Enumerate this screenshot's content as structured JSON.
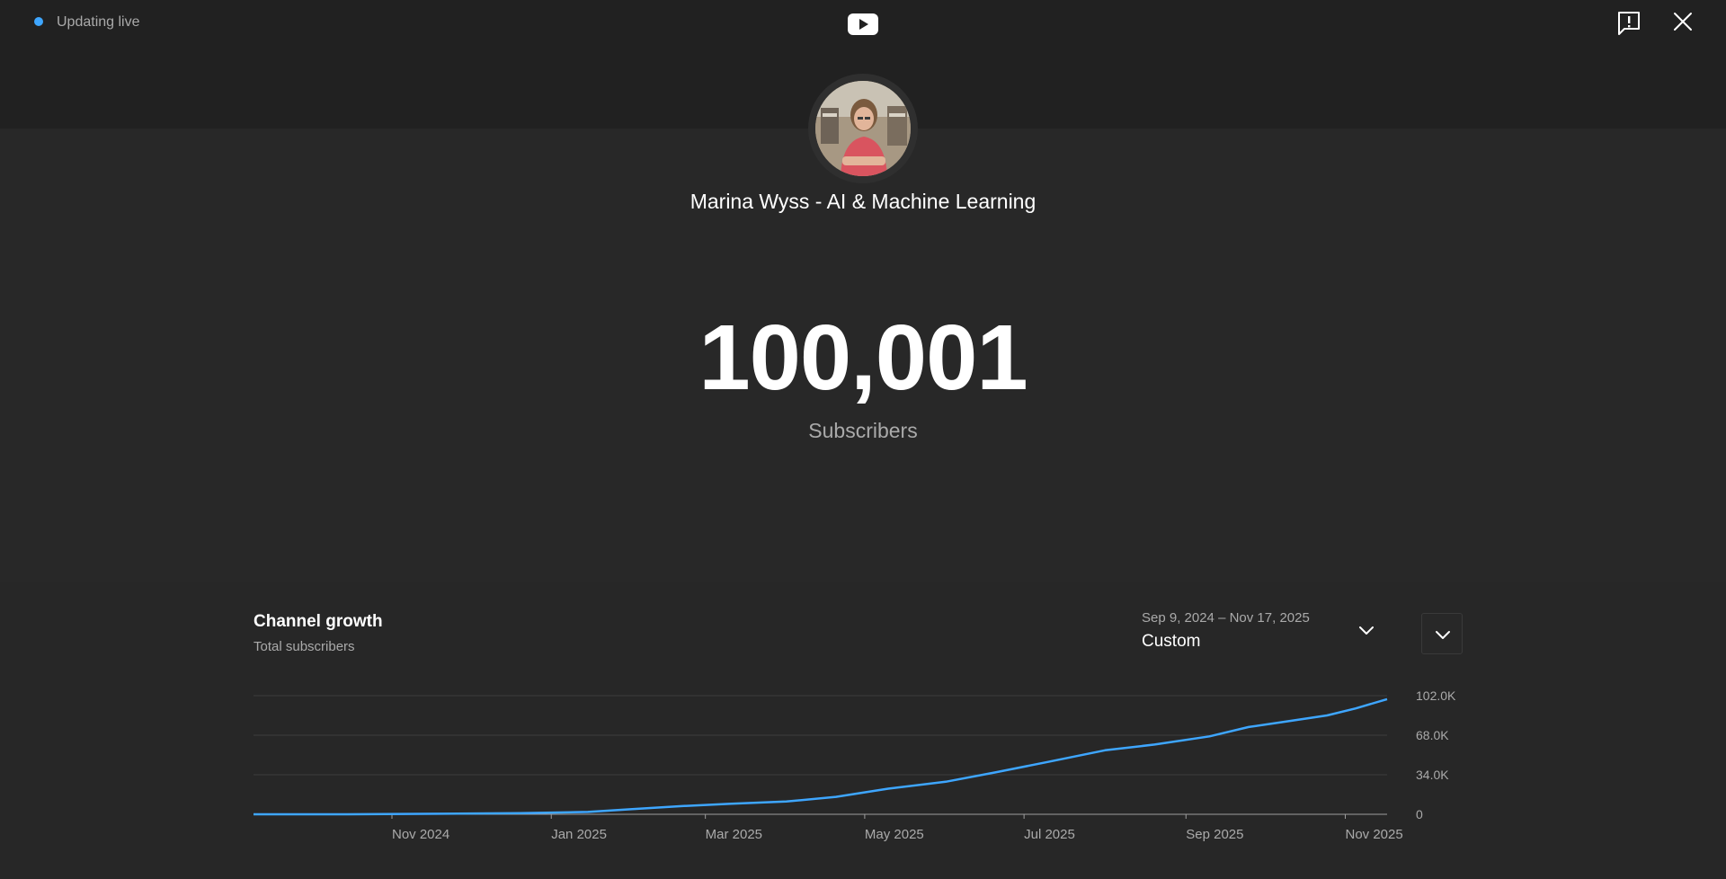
{
  "header": {
    "live_label": "Updating live",
    "live_color": "#3ea6ff"
  },
  "icons": {
    "logo": "youtube-logo-icon",
    "feedback": "feedback-icon",
    "close": "close-icon",
    "dropdown": "chevron-down-icon",
    "expand": "chevron-down-icon"
  },
  "channel": {
    "name": "Marina Wyss - AI & Machine Learning",
    "subscriber_count": "100,001",
    "subscriber_label": "Subscribers"
  },
  "growth": {
    "title": "Channel growth",
    "subtitle": "Total subscribers",
    "range_dates": "Sep 9, 2024 – Nov 17, 2025",
    "range_mode": "Custom"
  },
  "chart_data": {
    "type": "line",
    "title": "Channel growth",
    "subtitle": "Total subscribers",
    "xlabel": "",
    "ylabel": "",
    "x_ticks": [
      "Nov 2024",
      "Jan 2025",
      "Mar 2025",
      "May 2025",
      "Jul 2025",
      "Sep 2025",
      "Nov 2025"
    ],
    "y_ticks": [
      "0",
      "34.0K",
      "68.0K",
      "102.0K"
    ],
    "ylim": [
      0,
      102000
    ],
    "xlim": [
      "2024-09-09",
      "2025-11-17"
    ],
    "grid": true,
    "line_color": "#3ea6ff",
    "series": [
      {
        "x": [
          "2024-09-09",
          "2024-10-15",
          "2024-11-20",
          "2024-12-20",
          "2025-01-15",
          "2025-02-01",
          "2025-02-20",
          "2025-03-10",
          "2025-04-01",
          "2025-04-20",
          "2025-05-10",
          "2025-06-01",
          "2025-06-20",
          "2025-07-10",
          "2025-08-01",
          "2025-08-20",
          "2025-09-10",
          "2025-09-25",
          "2025-10-10",
          "2025-10-25",
          "2025-11-05",
          "2025-11-17"
        ],
        "values": [
          0,
          0,
          500,
          1000,
          2000,
          4500,
          7000,
          9000,
          11000,
          15000,
          22000,
          28000,
          36000,
          45000,
          55000,
          60000,
          67000,
          75000,
          80000,
          85000,
          91000,
          99000
        ]
      }
    ]
  }
}
